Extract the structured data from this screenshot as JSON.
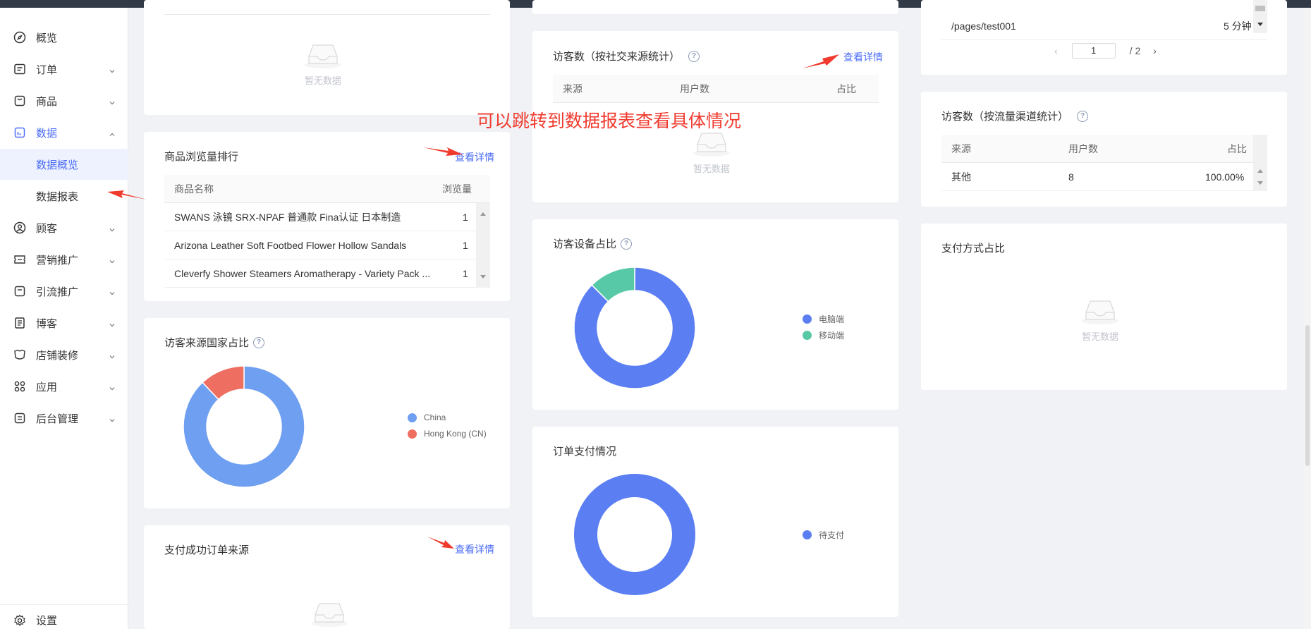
{
  "sidebar": {
    "items": [
      {
        "label": "概览",
        "icon": "compass-icon"
      },
      {
        "label": "订单",
        "icon": "order-icon"
      },
      {
        "label": "商品",
        "icon": "bag-icon"
      },
      {
        "label": "数据",
        "icon": "chart-icon"
      },
      {
        "label": "顾客",
        "icon": "user-icon"
      },
      {
        "label": "营销推广",
        "icon": "ticket-icon"
      },
      {
        "label": "引流推广",
        "icon": "traffic-icon"
      },
      {
        "label": "博客",
        "icon": "document-icon"
      },
      {
        "label": "店铺装修",
        "icon": "shirt-icon"
      },
      {
        "label": "应用",
        "icon": "apps-icon"
      },
      {
        "label": "后台管理",
        "icon": "admin-icon"
      }
    ],
    "sub_items": [
      {
        "label": "数据概览"
      },
      {
        "label": "数据报表"
      }
    ],
    "settings_label": "设置"
  },
  "common": {
    "empty_text": "暂无数据",
    "detail_link": "查看详情"
  },
  "annotation": {
    "text": "可以跳转到数据报表查看具体情况"
  },
  "product_views": {
    "title": "商品浏览量排行",
    "columns": [
      "商品名称",
      "浏览量"
    ],
    "rows": [
      {
        "name": "SWANS 泳镜 SRX-NPAF 普通款 Fina认证 日本制造",
        "views": "1"
      },
      {
        "name": "Arizona Leather Soft Footbed Flower Hollow Sandals",
        "views": "1"
      },
      {
        "name": "Cleverfy Shower Steamers Aromatherapy - Variety Pack ...",
        "views": "1"
      }
    ]
  },
  "visitor_country": {
    "title": "访客来源国家占比"
  },
  "paid_orders_source": {
    "title": "支付成功订单来源"
  },
  "social_visitors": {
    "title": "访客数（按社交来源统计）",
    "columns": [
      "来源",
      "用户数",
      "占比"
    ]
  },
  "device_share": {
    "title": "访客设备占比"
  },
  "order_payment": {
    "title": "订单支付情况"
  },
  "page_list": {
    "row_path": "/pages/test001",
    "row_time": "5 分钟",
    "pager_current": "1",
    "pager_total": "/  2"
  },
  "channel_visitors": {
    "title": "访客数（按流量渠道统计）",
    "columns": [
      "来源",
      "用户数",
      "占比"
    ],
    "rows": [
      {
        "source": "其他",
        "users": "8",
        "ratio": "100.00%"
      }
    ]
  },
  "payment_method": {
    "title": "支付方式占比"
  },
  "colors": {
    "accent": "#4a6cf7",
    "annotation": "#f03a2e"
  },
  "chart_data": [
    {
      "type": "pie",
      "categories": [
        "China",
        "Hong Kong (CN)"
      ],
      "values": [
        88,
        12
      ],
      "colors": [
        "#6f9ff0",
        "#ee6f62"
      ],
      "title": "访客来源国家占比",
      "legend": "right"
    },
    {
      "type": "pie",
      "categories": [
        "电脑端",
        "移动端"
      ],
      "values": [
        87.5,
        12.5
      ],
      "colors": [
        "#5b7ff3",
        "#58c9a6"
      ],
      "title": "访客设备占比",
      "legend": "right"
    },
    {
      "type": "pie",
      "categories": [
        "待支付"
      ],
      "values": [
        100
      ],
      "colors": [
        "#5b7ff3"
      ],
      "title": "订单支付情况",
      "legend": "right"
    }
  ]
}
